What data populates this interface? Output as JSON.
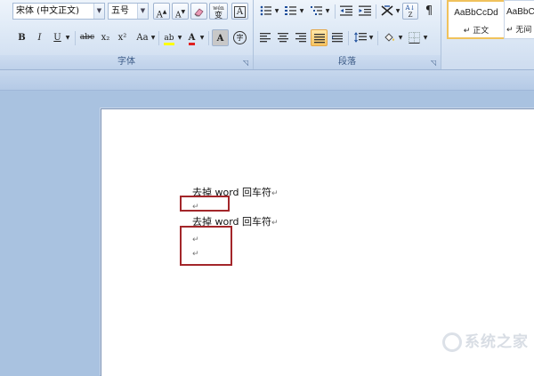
{
  "font_group": {
    "font_name": "宋体 (中文正文)",
    "font_size": "五号",
    "grow_font": "A",
    "shrink_font": "A",
    "clear_format": "",
    "phonetic": "wén",
    "phonetic_char": "变",
    "char_border": "A",
    "bold": "B",
    "italic": "I",
    "underline": "U",
    "strikethrough": "abc",
    "subscript": "x₂",
    "superscript": "x²",
    "change_case": "Aa",
    "highlight": "ab",
    "font_color": "A",
    "enclose_char": "字",
    "label": "字体"
  },
  "paragraph_group": {
    "label": "段落"
  },
  "styles_group": {
    "styles": [
      {
        "sample": "AaBbCcDd",
        "name": "↵ 正文"
      },
      {
        "sample": "AaBbC",
        "name": "↵ 无间"
      }
    ]
  },
  "document": {
    "lines": [
      {
        "text": "去掉 word 回车符",
        "mark": "↵"
      },
      {
        "text": "",
        "mark": "↵"
      },
      {
        "text": "去掉 word 回车符",
        "mark": "↵"
      },
      {
        "text": "",
        "mark": "↵"
      },
      {
        "text": "",
        "mark": "↵"
      }
    ]
  },
  "watermark": {
    "text": "系统之家"
  },
  "colors": {
    "highlight_box": "#a3262a",
    "ribbon_bg": "#dbe7f5",
    "workspace_bg": "#a9c2e0"
  }
}
